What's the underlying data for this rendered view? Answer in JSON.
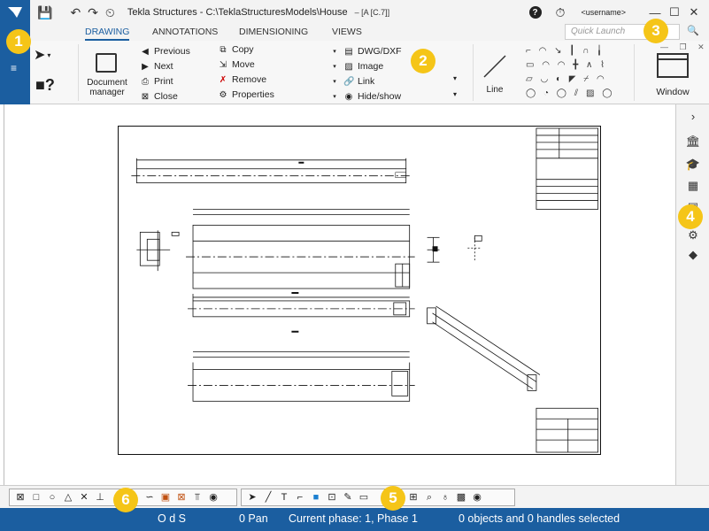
{
  "title_bar": {
    "app_title": "Tekla Structures - C:\\TeklaStructuresModels\\House",
    "context_tag": "– [A  [C.7]]",
    "username": "<username>",
    "help_icon": "question-circle-icon",
    "timer_icon": "stopwatch-icon",
    "minimize": "—",
    "maximize": "☐",
    "close": "✕"
  },
  "tabs": [
    {
      "label": "DRAWING",
      "active": true
    },
    {
      "label": "ANNOTATIONS",
      "active": false
    },
    {
      "label": "DIMENSIONING",
      "active": false
    },
    {
      "label": "VIEWS",
      "active": false
    }
  ],
  "quick_launch": {
    "placeholder": "Quick Launch"
  },
  "ribbon": {
    "document_manager": "Document manager",
    "nav": [
      "Previous",
      "Next",
      "Print",
      "Close"
    ],
    "edit": [
      "Copy",
      "Move",
      "Remove",
      "Properties"
    ],
    "insert": [
      "DWG/DXF",
      "Image",
      "Link",
      "Hide/show"
    ],
    "line_label": "Line",
    "window_label": "Window"
  },
  "status_bar": {
    "snap_mode": "O d S",
    "pan": "0  Pan",
    "phase": "Current phase: 1, Phase 1",
    "selection": "0 objects and 0 handles selected"
  },
  "callouts": [
    "1",
    "2",
    "3",
    "4",
    "5",
    "6"
  ],
  "colors": {
    "brand": "#1b5ea0",
    "callout": "#f5c518"
  }
}
